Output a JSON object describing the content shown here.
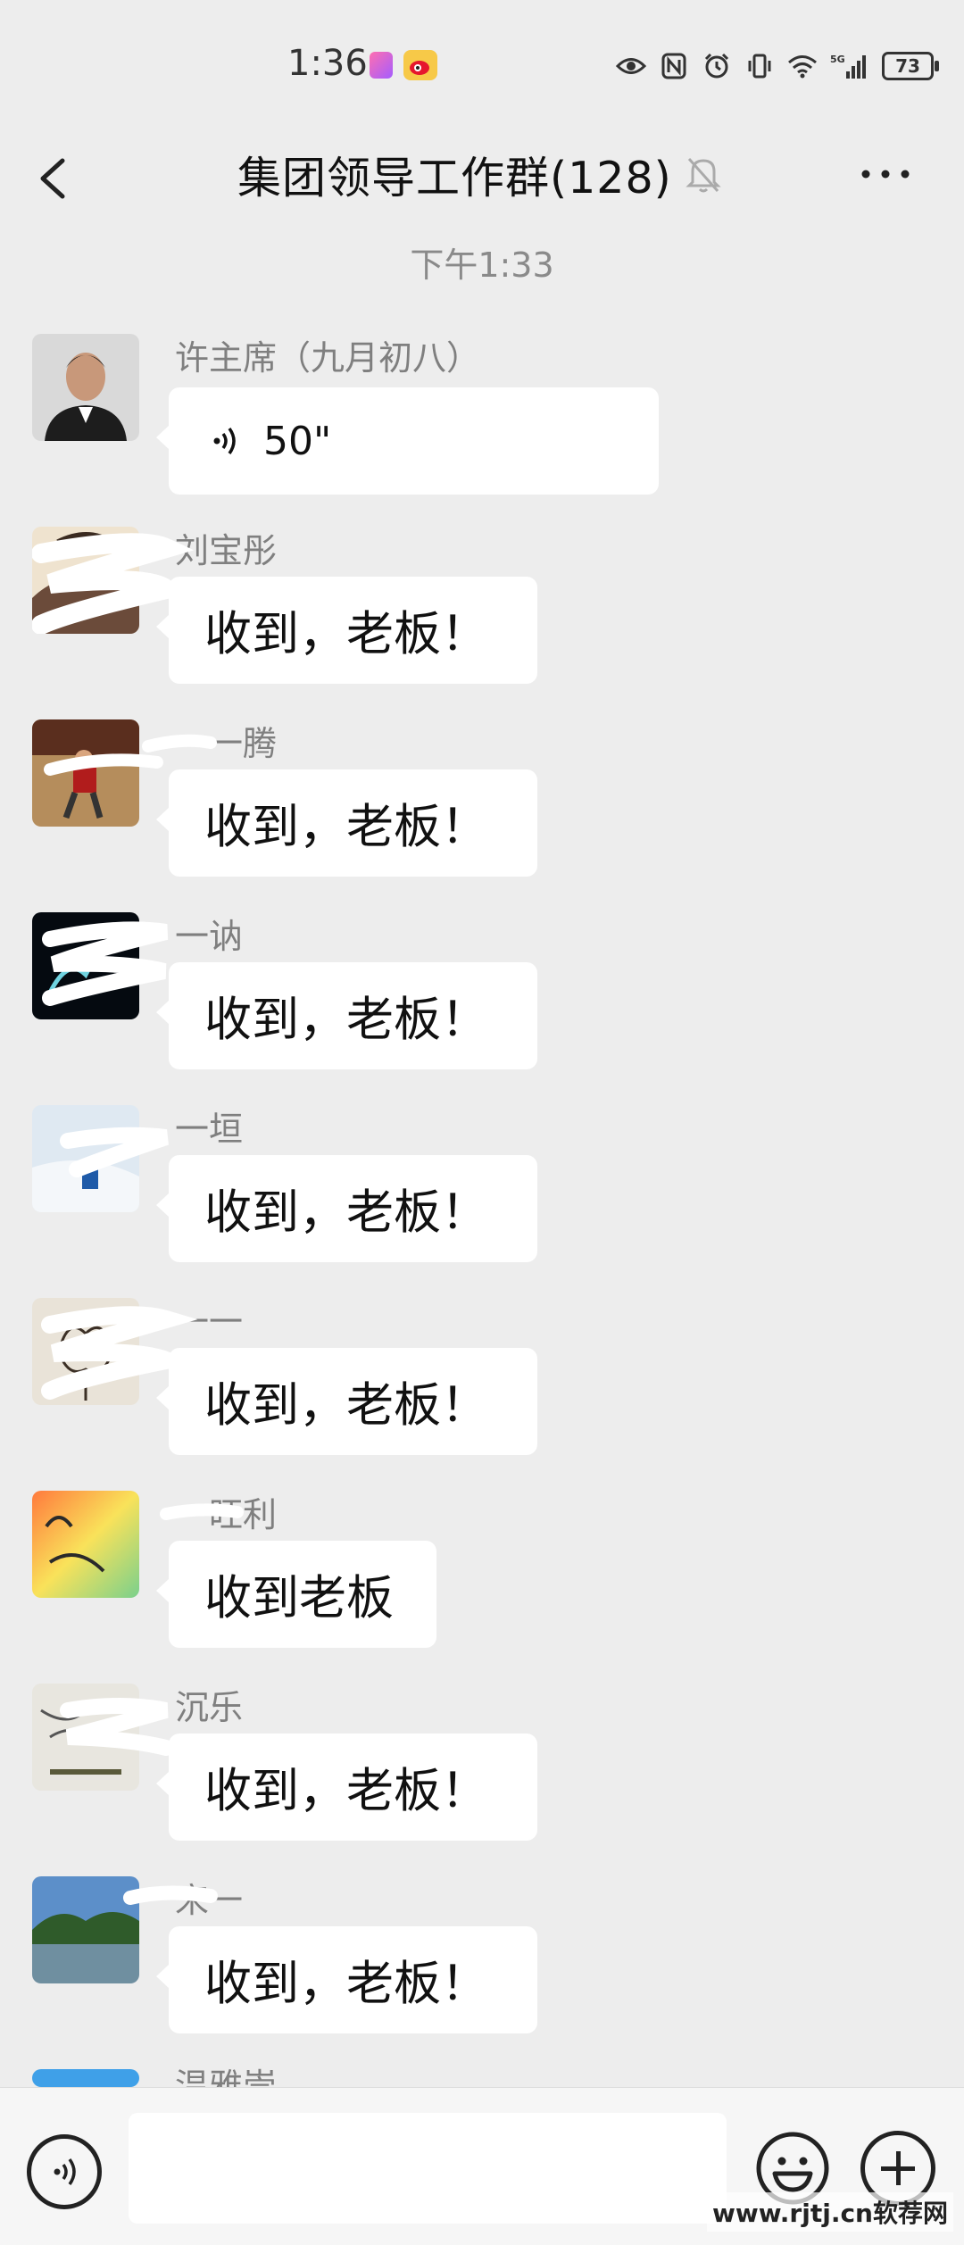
{
  "status_bar": {
    "time": "1:36",
    "battery": "73",
    "network": "5G"
  },
  "header": {
    "title": "集团领导工作群(128)",
    "muted": true
  },
  "timestamp": "下午1:33",
  "messages": [
    {
      "sender": "许主席（九月初八）",
      "type": "voice",
      "text": "50\""
    },
    {
      "sender": "刘宝彤",
      "type": "text",
      "text": "收到，老板！"
    },
    {
      "sender": "一一腾",
      "type": "text",
      "text": "收到，老板！"
    },
    {
      "sender": "一讷",
      "type": "text",
      "text": "收到，老板！"
    },
    {
      "sender": "一垣",
      "type": "text",
      "text": "收到，老板！"
    },
    {
      "sender": "一一",
      "type": "text",
      "text": "收到，老板！"
    },
    {
      "sender": "一旺利",
      "type": "text",
      "text": "收到老板"
    },
    {
      "sender": "沉乐",
      "type": "text",
      "text": "收到，老板！"
    },
    {
      "sender": "宋一",
      "type": "text",
      "text": "收到，老板！"
    },
    {
      "sender": "温雅崇",
      "type": "text",
      "text": ""
    }
  ],
  "input": {
    "placeholder": ""
  },
  "watermark": "www.rjtj.cn软荐网",
  "colors": {
    "background": "#ededed",
    "bubble": "#ffffff",
    "sender": "#7f7f7f"
  }
}
